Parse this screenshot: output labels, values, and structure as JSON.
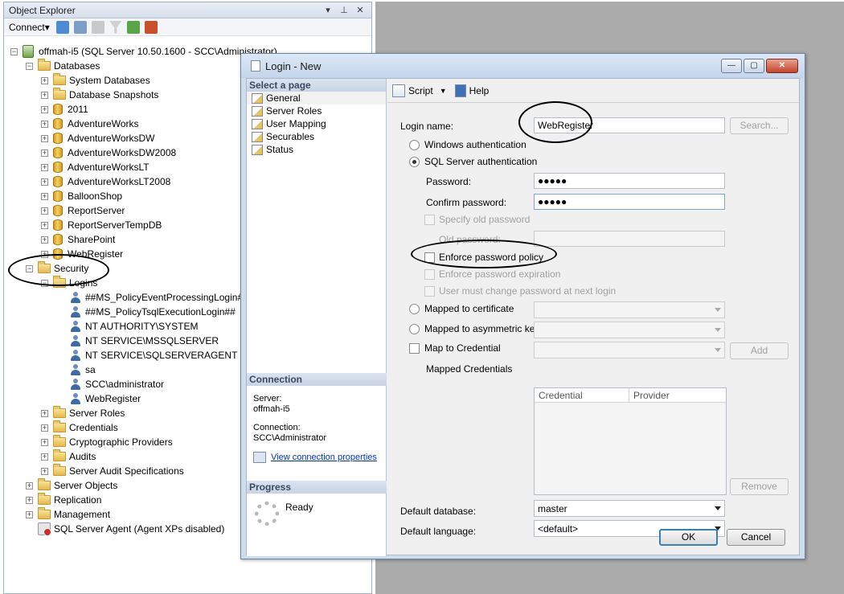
{
  "object_explorer": {
    "title": "Object Explorer",
    "pin_buttons": [
      "▾",
      "⊥",
      "✕"
    ],
    "connect_label": "Connect",
    "tree": [
      {
        "label": "offmah-i5 (SQL Server 10.50.1600 - SCC\\Administrator)",
        "icon": "server-icon",
        "exp": "⊟"
      },
      {
        "label": "Databases",
        "icon": "folder-icon",
        "exp": "⊟"
      },
      {
        "label": "System Databases",
        "icon": "folder-icon",
        "exp": "⊞"
      },
      {
        "label": "Database Snapshots",
        "icon": "folder-icon",
        "exp": "⊞"
      },
      {
        "label": "2011",
        "icon": "database-icon",
        "exp": "⊞"
      },
      {
        "label": "AdventureWorks",
        "icon": "database-icon",
        "exp": "⊞"
      },
      {
        "label": "AdventureWorksDW",
        "icon": "database-icon",
        "exp": "⊞"
      },
      {
        "label": "AdventureWorksDW2008",
        "icon": "database-icon",
        "exp": "⊞"
      },
      {
        "label": "AdventureWorksLT",
        "icon": "database-icon",
        "exp": "⊞"
      },
      {
        "label": "AdventureWorksLT2008",
        "icon": "database-icon",
        "exp": "⊞"
      },
      {
        "label": "BalloonShop",
        "icon": "database-icon",
        "exp": "⊞"
      },
      {
        "label": "ReportServer",
        "icon": "database-icon",
        "exp": "⊞"
      },
      {
        "label": "ReportServerTempDB",
        "icon": "database-icon",
        "exp": "⊞"
      },
      {
        "label": "SharePoint",
        "icon": "database-icon",
        "exp": "⊞"
      },
      {
        "label": "WebRegister",
        "icon": "database-icon",
        "exp": "⊞"
      },
      {
        "label": "Security",
        "icon": "folder-icon",
        "exp": "⊟"
      },
      {
        "label": "Logins",
        "icon": "folder-icon",
        "exp": "⊟"
      },
      {
        "label": "##MS_PolicyEventProcessingLogin##",
        "icon": "login-icon",
        "exp": ""
      },
      {
        "label": "##MS_PolicyTsqlExecutionLogin##",
        "icon": "login-icon",
        "exp": ""
      },
      {
        "label": "NT AUTHORITY\\SYSTEM",
        "icon": "login-icon",
        "exp": ""
      },
      {
        "label": "NT SERVICE\\MSSQLSERVER",
        "icon": "group-login-icon",
        "exp": ""
      },
      {
        "label": "NT SERVICE\\SQLSERVERAGENT",
        "icon": "group-login-icon",
        "exp": ""
      },
      {
        "label": "sa",
        "icon": "login-icon",
        "exp": ""
      },
      {
        "label": "SCC\\administrator",
        "icon": "login-icon",
        "exp": ""
      },
      {
        "label": "WebRegister",
        "icon": "login-icon",
        "exp": ""
      },
      {
        "label": "Server Roles",
        "icon": "folder-icon",
        "exp": "⊞"
      },
      {
        "label": "Credentials",
        "icon": "folder-icon",
        "exp": "⊞"
      },
      {
        "label": "Cryptographic Providers",
        "icon": "folder-icon",
        "exp": "⊞"
      },
      {
        "label": "Audits",
        "icon": "folder-icon",
        "exp": "⊞"
      },
      {
        "label": "Server Audit Specifications",
        "icon": "folder-icon",
        "exp": "⊞"
      },
      {
        "label": "Server Objects",
        "icon": "folder-icon",
        "exp": "⊞"
      },
      {
        "label": "Replication",
        "icon": "folder-icon",
        "exp": "⊞"
      },
      {
        "label": "Management",
        "icon": "folder-icon",
        "exp": "⊞"
      },
      {
        "label": "SQL Server Agent (Agent XPs disabled)",
        "icon": "agent-icon",
        "exp": ""
      }
    ]
  },
  "dialog": {
    "title": "Login - New",
    "window_buttons": {
      "minimize": "—",
      "maximize": "▢",
      "close": "✕"
    },
    "select_page_header": "Select a page",
    "pages": [
      "General",
      "Server Roles",
      "User Mapping",
      "Securables",
      "Status"
    ],
    "connection_header": "Connection",
    "server_label": "Server:",
    "server_value": "offmah-i5",
    "connection_label": "Connection:",
    "connection_value": "SCC\\Administrator",
    "view_connection_link": "View connection properties",
    "progress_header": "Progress",
    "progress_status": "Ready",
    "toolbar": {
      "script": "Script",
      "help": "Help"
    },
    "form": {
      "login_name_label": "Login name:",
      "login_name_value": "WebRegister",
      "search_button": "Search...",
      "windows_auth": "Windows authentication",
      "sql_auth": "SQL Server authentication",
      "password_label": "Password:",
      "password_value": "●●●●●",
      "confirm_label": "Confirm password:",
      "confirm_value": "●●●●●",
      "specify_old": "Specify old password",
      "old_password_label": "Old password:",
      "enforce_policy": "Enforce password policy",
      "enforce_expiration": "Enforce password expiration",
      "must_change": "User must change password at next login",
      "mapped_cert": "Mapped to certificate",
      "mapped_asym": "Mapped to asymmetric key",
      "map_credential": "Map to Credential",
      "add_button": "Add",
      "mapped_credentials": "Mapped Credentials",
      "grid_col_credential": "Credential",
      "grid_col_provider": "Provider",
      "remove_button": "Remove",
      "default_db_label": "Default database:",
      "default_db_value": "master",
      "default_lang_label": "Default language:",
      "default_lang_value": "<default>"
    },
    "ok_button": "OK",
    "cancel_button": "Cancel"
  }
}
